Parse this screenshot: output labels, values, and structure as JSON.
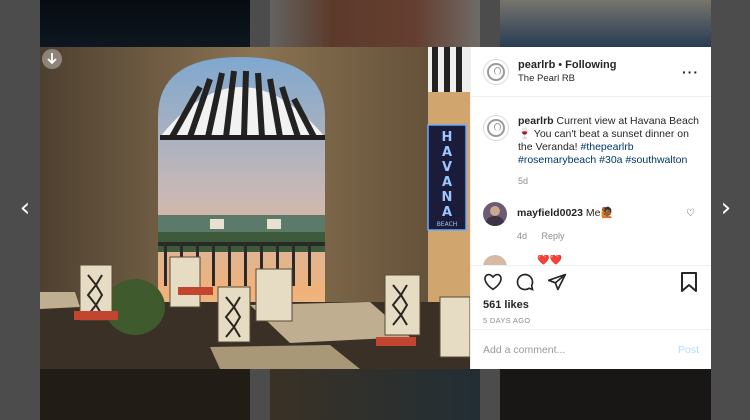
{
  "post": {
    "username": "pearlrb",
    "following_label": "Following",
    "location": "The Pearl RB",
    "caption_text": "Current view at Havana Beach 🍷 You can't beat a sunset dinner on the Veranda!",
    "hashtags": [
      "#thepearlrb",
      "#rosemarybeach",
      "#30a",
      "#southwalton"
    ],
    "caption_time": "5d",
    "likes": "561 likes",
    "posted_ago": "5 DAYS AGO"
  },
  "comments": [
    {
      "username": "mayfield0023",
      "text": "Me🙋🏾",
      "time": "4d",
      "reply_label": "Reply"
    }
  ],
  "partial_comment_text": "❤️❤️",
  "add_comment": {
    "placeholder": "Add a comment...",
    "post_label": "Post"
  },
  "sign": {
    "letters": [
      "H",
      "A",
      "V",
      "A",
      "N",
      "A"
    ],
    "sub": "BEACH"
  },
  "icons": [
    "arrow-left-icon",
    "arrow-right-icon",
    "more-icon",
    "heart-icon",
    "comment-icon",
    "share-icon",
    "save-icon",
    "download-icon"
  ],
  "colors": {
    "link": "#00376b",
    "post_button": "#b2dffc",
    "sign_neon": "#6aa8ff"
  }
}
